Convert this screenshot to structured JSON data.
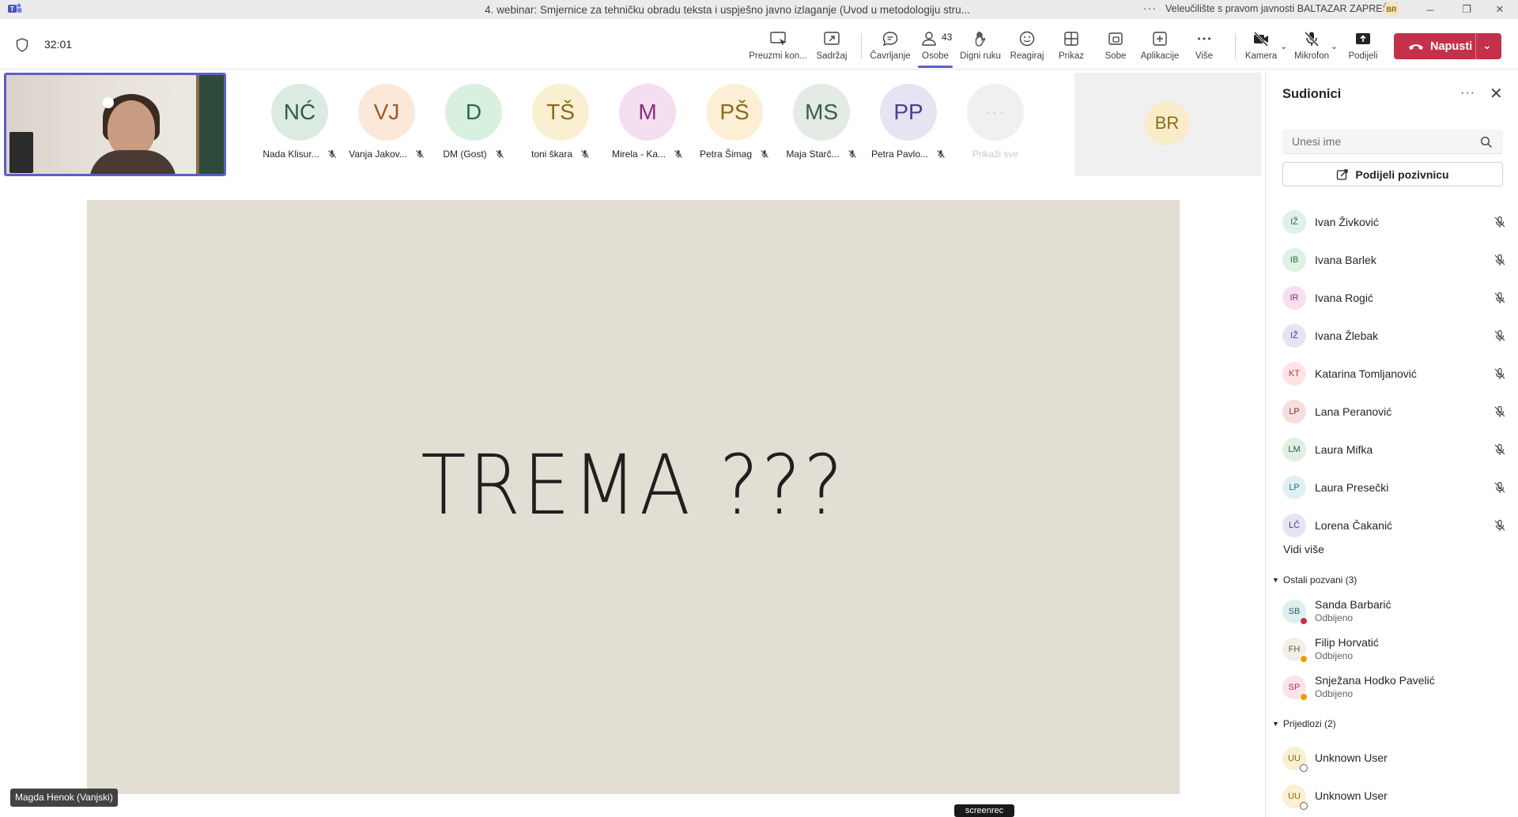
{
  "window": {
    "title": "4. webinar: Smjernice za tehničku obradu teksta i uspješno javno izlaganje (Uvod u metodologiju stru...",
    "more_label": "···",
    "org_name": "Veleučilište s pravom javnosti BALTAZAR ZAPREŠIĆ",
    "org_avatar": "BR",
    "minimize": "─",
    "restore": "❐",
    "close": "✕"
  },
  "meeting": {
    "timer": "32:01"
  },
  "toolbar": {
    "preuzmi": "Preuzmi kon...",
    "sadrzaj": "Sadržaj",
    "cavrljanje": "Čavrljanje",
    "osobe": "Osobe",
    "osobe_count": "43",
    "digni_ruku": "Digni ruku",
    "reagiraj": "Reagiraj",
    "prikaz": "Prikaz",
    "sobe": "Sobe",
    "aplikacije": "Aplikacije",
    "vise": "Više",
    "kamera": "Kamera",
    "mikrofon": "Mikrofon",
    "podijeli": "Podijeli",
    "leave": "Napusti"
  },
  "participants_strip": [
    {
      "initials": "NĆ",
      "name": "Nada Klisur...",
      "bg": "#dcebe1",
      "fg": "#2f5d44"
    },
    {
      "initials": "VJ",
      "name": "Vanja Jakov...",
      "bg": "#fbe8d8",
      "fg": "#9a5a2a"
    },
    {
      "initials": "D",
      "name": "DM (Gost)",
      "bg": "#d9efe0",
      "fg": "#2b6b44"
    },
    {
      "initials": "TŠ",
      "name": "toni škara",
      "bg": "#fbefd1",
      "fg": "#8a6a1a"
    },
    {
      "initials": "M",
      "name": "Mirela - Ka...",
      "bg": "#f3dff0",
      "fg": "#8a2f7a"
    },
    {
      "initials": "PŠ",
      "name": "Petra Šimag",
      "bg": "#fcefd6",
      "fg": "#8a6a1a"
    },
    {
      "initials": "MS",
      "name": "Maja Starč...",
      "bg": "#e3ebe4",
      "fg": "#3b5e46"
    },
    {
      "initials": "PP",
      "name": "Petra Pavlo...",
      "bg": "#e6e3f3",
      "fg": "#4a3f8a"
    }
  ],
  "show_all": {
    "icon": "···",
    "label": "Prikaži sve"
  },
  "br_tile": {
    "initials": "BR"
  },
  "slide": {
    "text": "TREMA ???"
  },
  "speaker_label": "Magda Henok (Vanjski)",
  "watermark": "screenrec",
  "panel": {
    "title": "Sudionici",
    "search_placeholder": "Unesi ime",
    "share_invite": "Podijeli pozivnicu",
    "attendees": [
      {
        "initials": "IŽ",
        "name": "Ivan Živković",
        "bg": "#e0f0ea",
        "fg": "#2b6b54"
      },
      {
        "initials": "IB",
        "name": "Ivana Barlek",
        "bg": "#dff0e4",
        "fg": "#2b6b44"
      },
      {
        "initials": "IR",
        "name": "Ivana Rogić",
        "bg": "#f6e0ef",
        "fg": "#8a2f7a"
      },
      {
        "initials": "IŽ",
        "name": "Ivana Žlebak",
        "bg": "#e6e4f4",
        "fg": "#4a3f8a"
      },
      {
        "initials": "KT",
        "name": "Katarina Tomljanović",
        "bg": "#fde4e4",
        "fg": "#a33a3a"
      },
      {
        "initials": "LP",
        "name": "Lana Peranović",
        "bg": "#f7dede",
        "fg": "#8a2f2f"
      },
      {
        "initials": "LM",
        "name": "Laura Mifka",
        "bg": "#e2efe4",
        "fg": "#2f5d44"
      },
      {
        "initials": "LP",
        "name": "Laura Presečki",
        "bg": "#e0f1f6",
        "fg": "#2a6a80"
      },
      {
        "initials": "LČ",
        "name": "Lorena Čakanić",
        "bg": "#e6e4f4",
        "fg": "#4a3f8a"
      }
    ],
    "see_more": "Vidi više",
    "invited_section": "Ostali pozvani (3)",
    "invited": [
      {
        "initials": "SB",
        "name": "Sanda Barbarić",
        "status": "Odbijeno",
        "bg": "#e0eef0",
        "fg": "#2a6070",
        "dot": "#c4314b"
      },
      {
        "initials": "FH",
        "name": "Filip Horvatić",
        "status": "Odbijeno",
        "bg": "#f1efe6",
        "fg": "#6a5a3a",
        "dot": "#e5a000"
      },
      {
        "initials": "SP",
        "name": "Snježana Hodko Pavelić",
        "status": "Odbijeno",
        "bg": "#fbe4e8",
        "fg": "#a33a4f",
        "dot": "#e5a000"
      }
    ],
    "suggestions_section": "Prijedlozi (2)",
    "suggestions": [
      {
        "initials": "UU",
        "name": "Unknown User",
        "bg": "#fbefd1",
        "fg": "#8a6a1a"
      },
      {
        "initials": "UU",
        "name": "Unknown User",
        "bg": "#fbefd1",
        "fg": "#8a6a1a"
      }
    ]
  }
}
